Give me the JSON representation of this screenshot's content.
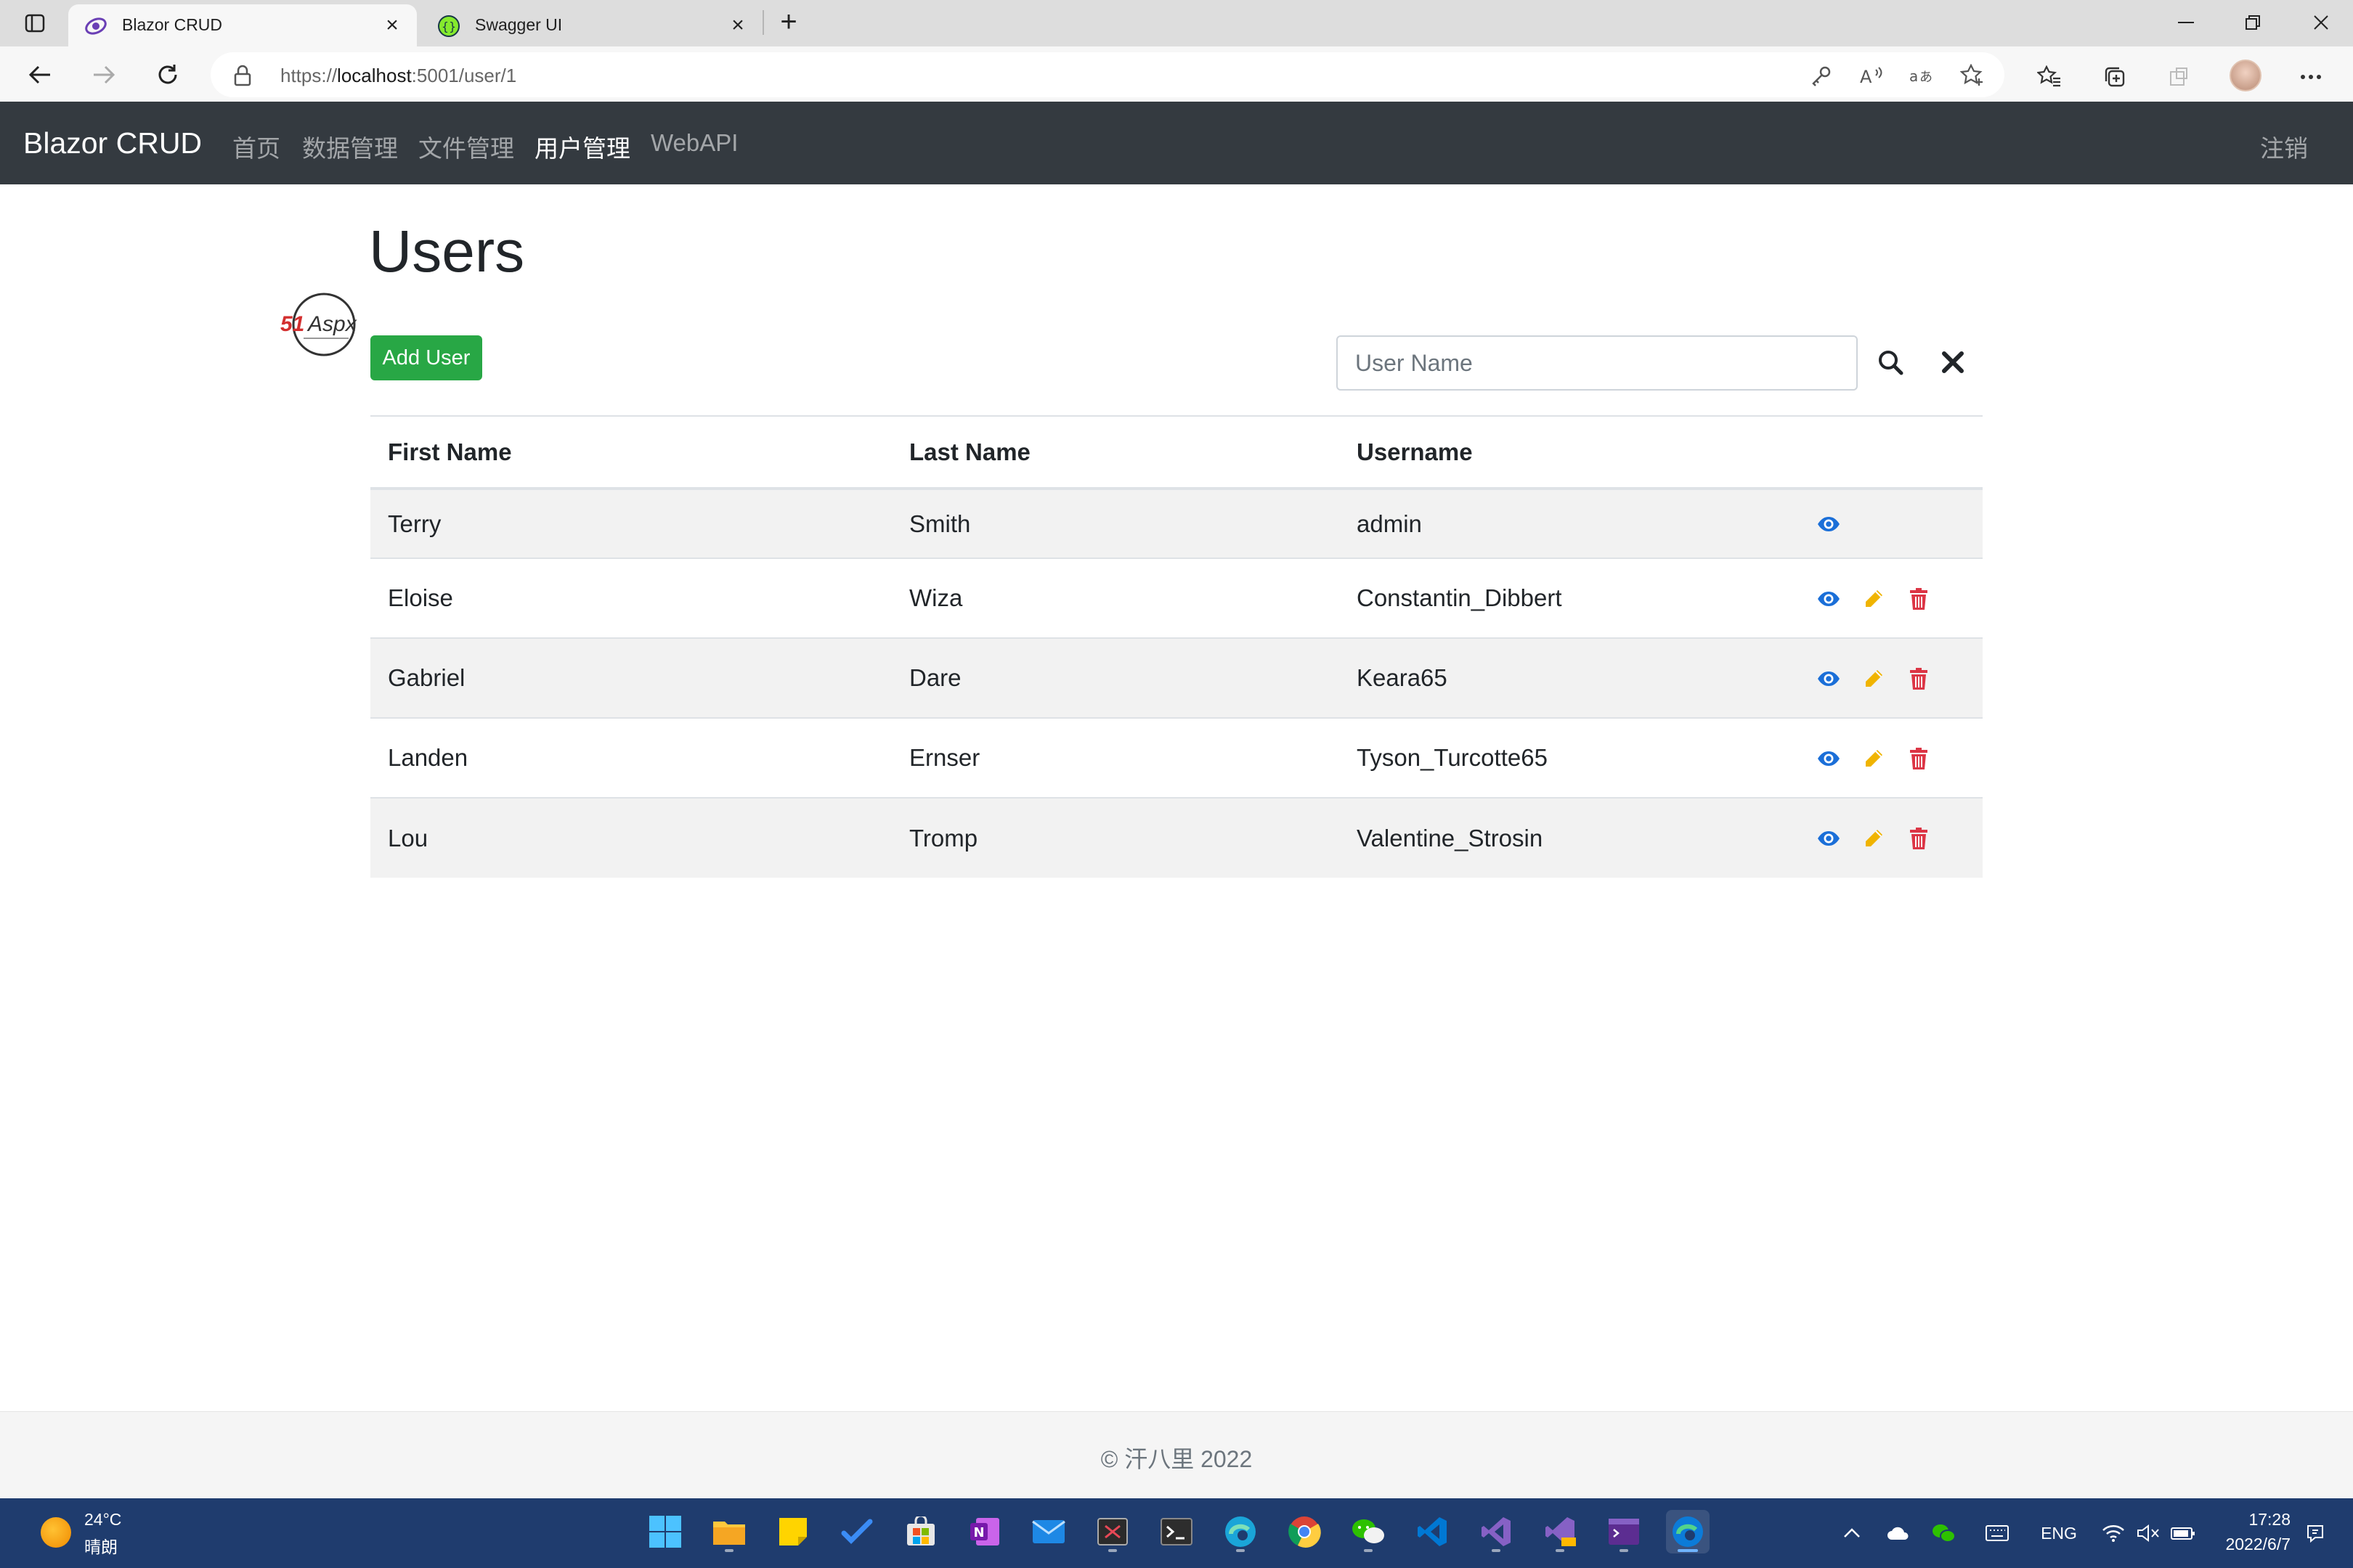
{
  "browser": {
    "tabs": [
      {
        "title": "Blazor CRUD",
        "active": true
      },
      {
        "title": "Swagger UI",
        "active": false
      }
    ],
    "url_prefix": "https://",
    "url_host": "localhost",
    "url_rest": ":5001/user/1"
  },
  "navbar": {
    "brand": "Blazor CRUD",
    "links": [
      "首页",
      "数据管理",
      "文件管理",
      "用户管理",
      "WebAPI"
    ],
    "active_index": 3,
    "logout": "注销"
  },
  "page": {
    "title": "Users",
    "add_button": "Add User",
    "search_placeholder": "User Name",
    "logo_text": "51Aspx"
  },
  "table": {
    "headers": [
      "First Name",
      "Last Name",
      "Username"
    ],
    "rows": [
      {
        "first": "Terry",
        "last": "Smith",
        "username": "admin",
        "can_edit": false
      },
      {
        "first": "Eloise",
        "last": "Wiza",
        "username": "Constantin_Dibbert",
        "can_edit": true
      },
      {
        "first": "Gabriel",
        "last": "Dare",
        "username": "Keara65",
        "can_edit": true
      },
      {
        "first": "Landen",
        "last": "Ernser",
        "username": "Tyson_Turcotte65",
        "can_edit": true
      },
      {
        "first": "Lou",
        "last": "Tromp",
        "username": "Valentine_Strosin",
        "can_edit": true
      }
    ]
  },
  "footer": {
    "copyright": "© 汗八里 2022"
  },
  "taskbar": {
    "weather_temp": "24°C",
    "weather_desc": "晴朗",
    "language": "ENG",
    "time": "17:28",
    "date": "2022/6/7"
  },
  "colors": {
    "navbar_bg": "#343a40",
    "add_button": "#28a745",
    "view_icon": "#1b6fd8",
    "edit_icon": "#f0b400",
    "delete_icon": "#dc3545"
  }
}
